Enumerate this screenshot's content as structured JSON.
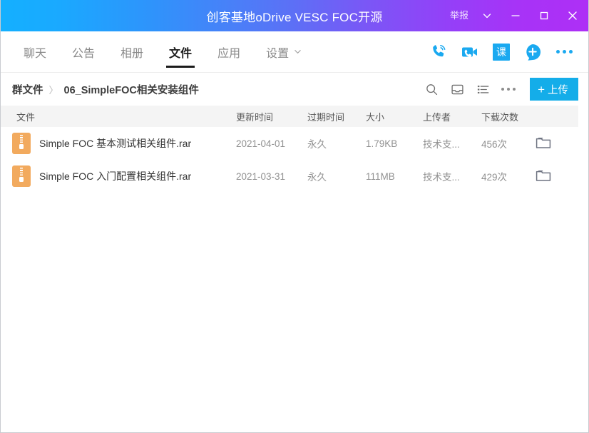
{
  "titlebar": {
    "title": "创客基地oDrive VESC FOC开源",
    "report_label": "举报",
    "dropdown_icon": "chevron-down-icon",
    "minimize_icon": "minimize-icon",
    "maximize_icon": "maximize-icon",
    "close_icon": "close-icon",
    "gradient_start": "#14b0ff",
    "gradient_end": "#ae2ff6"
  },
  "nav": {
    "tabs": [
      {
        "label": "聊天",
        "active": false
      },
      {
        "label": "公告",
        "active": false
      },
      {
        "label": "相册",
        "active": false
      },
      {
        "label": "文件",
        "active": true
      },
      {
        "label": "应用",
        "active": false
      },
      {
        "label": "设置",
        "active": false,
        "has_caret": true
      }
    ],
    "actions": [
      {
        "name": "voice-call-icon"
      },
      {
        "name": "video-call-icon"
      },
      {
        "name": "class-icon",
        "label": "课"
      },
      {
        "name": "add-member-icon"
      },
      {
        "name": "more-icon"
      }
    ],
    "accent": "#1aa9f0"
  },
  "breadcrumb": {
    "root": "群文件",
    "separator": "〉",
    "current": "06_SimpleFOC相关安装组件"
  },
  "toolbar": {
    "search_icon": "search-icon",
    "inbox_icon": "inbox-icon",
    "list-view_icon": "list-view-icon",
    "more_icon": "more-icon",
    "upload_plus": "+",
    "upload_label": "上传",
    "upload_color": "#14ade9"
  },
  "table": {
    "columns": {
      "file": "文件",
      "modified": "更新时间",
      "expire": "过期时间",
      "size": "大小",
      "uploader": "上传者",
      "downloads": "下载次数"
    },
    "rows": [
      {
        "icon": "rar-file-icon",
        "name": "Simple FOC 基本测试相关组件.rar",
        "modified": "2021-04-01",
        "expire": "永久",
        "size": "1.79KB",
        "uploader": "技术支...",
        "downloads": "456次",
        "action_icon": "folder-icon"
      },
      {
        "icon": "rar-file-icon",
        "name": "Simple FOC 入门配置相关组件.rar",
        "modified": "2021-03-31",
        "expire": "永久",
        "size": "111MB",
        "uploader": "技术支...",
        "downloads": "429次",
        "action_icon": "folder-icon"
      }
    ]
  }
}
